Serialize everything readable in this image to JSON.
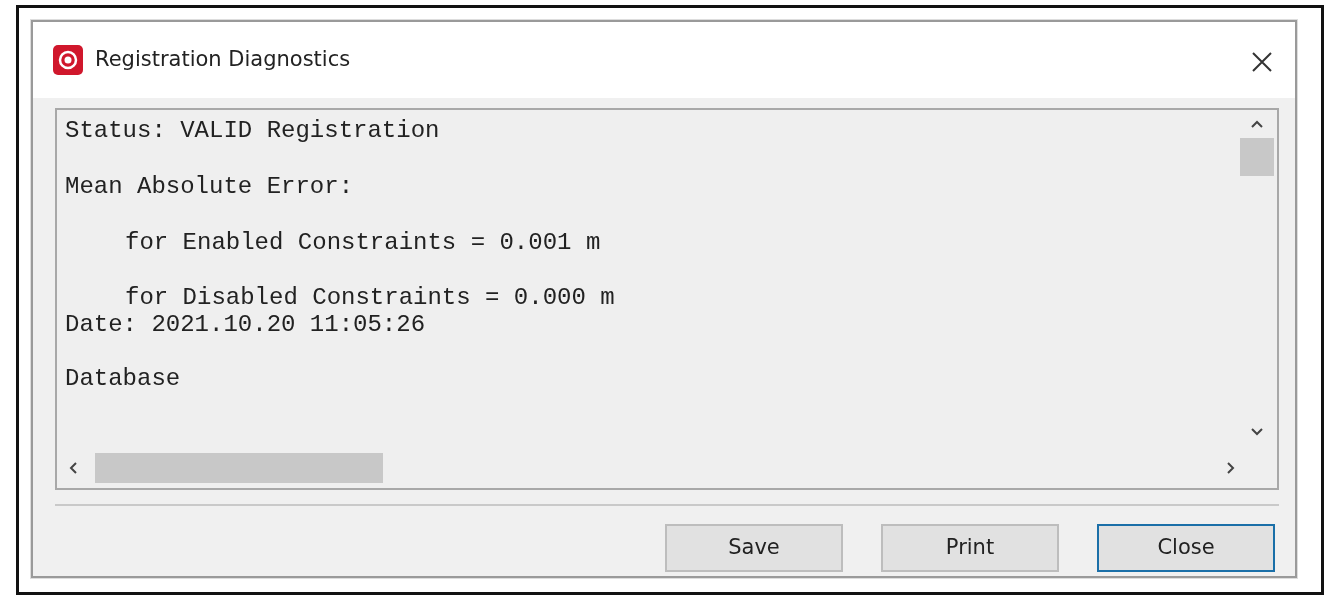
{
  "window": {
    "title": "Registration Diagnostics"
  },
  "report_lines": [
    {
      "text": "Status: VALID Registration",
      "indent": false
    },
    {
      "text": "Mean Absolute Error:",
      "indent": false
    },
    {
      "text": "for Enabled Constraints = 0.001 m",
      "indent": true
    },
    {
      "text": "for Disabled Constraints = 0.000 m",
      "indent": true
    },
    {
      "text": "Date: 2021.10.20 11:05:26",
      "indent": false
    },
    {
      "text": "Database",
      "indent": false
    }
  ],
  "buttons": [
    {
      "label": "Save",
      "default": false
    },
    {
      "label": "Print",
      "default": false
    },
    {
      "label": "Close",
      "default": true
    }
  ]
}
